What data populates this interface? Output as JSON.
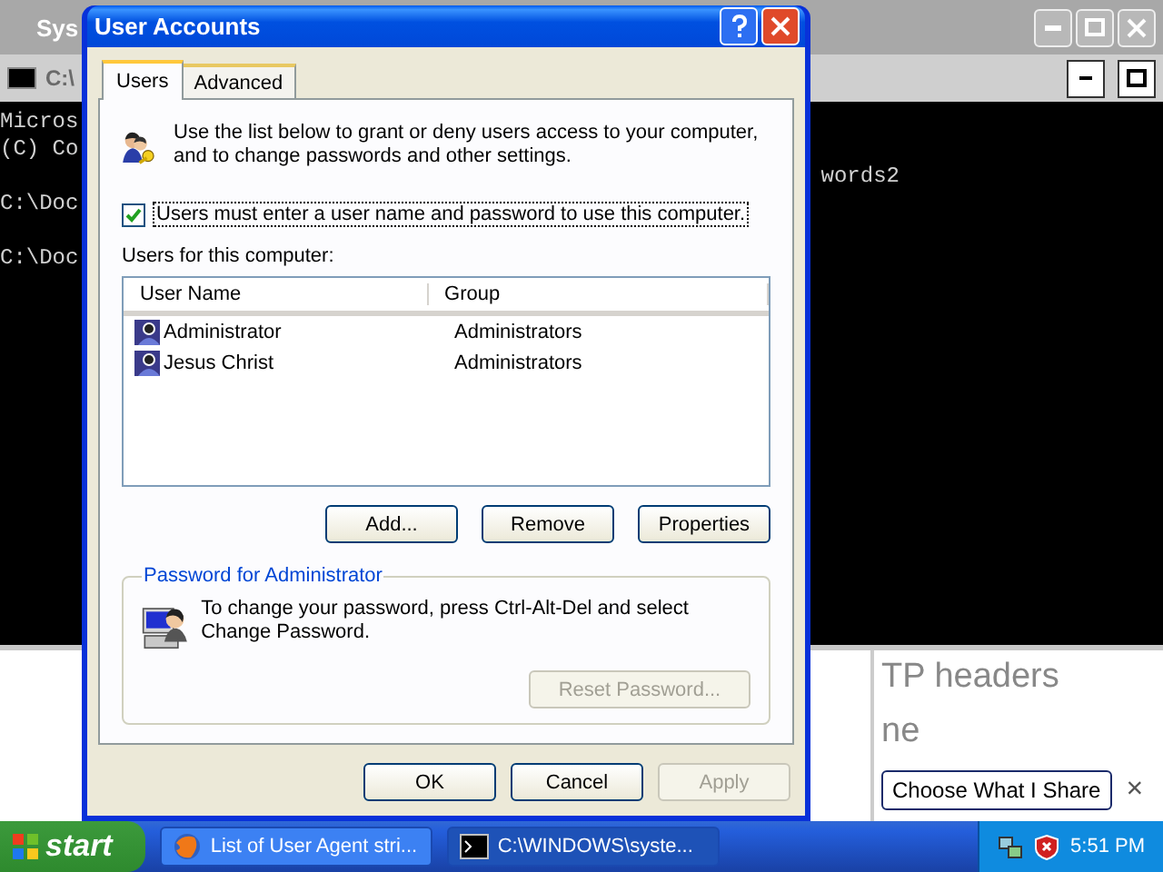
{
  "background": {
    "back_window": {
      "title": "Sys"
    },
    "console": {
      "title": "C:\\",
      "lines": [
        "Micros",
        "(C) Co",
        "C:\\Doc",
        "C:\\Doc"
      ],
      "fragment": "words2"
    },
    "browser": {
      "heading_parts": [
        "TP headers",
        "ne"
      ],
      "share_button": "Choose What I Share",
      "close_glyph": "×"
    }
  },
  "dialog": {
    "title": "User Accounts",
    "tabs": [
      {
        "label": "Users",
        "selected": true
      },
      {
        "label": "Advanced",
        "selected": false
      }
    ],
    "intro": "Use the list below to grant or deny users access to your computer, and to change passwords and other settings.",
    "require_login": {
      "label": "Users must enter a user name and password to use this computer.",
      "checked": true
    },
    "list_label": "Users for this computer:",
    "columns": [
      "User Name",
      "Group"
    ],
    "rows": [
      {
        "name": "Administrator",
        "group": "Administrators"
      },
      {
        "name": "Jesus Christ",
        "group": "Administrators"
      }
    ],
    "list_buttons": [
      {
        "label": "Add...",
        "disabled": false
      },
      {
        "label": "Remove",
        "disabled": false
      },
      {
        "label": "Properties",
        "disabled": false
      }
    ],
    "password_group": {
      "title": "Password for Administrator",
      "text": "To change your password, press Ctrl-Alt-Del and select Change Password.",
      "button": {
        "label": "Reset Password...",
        "disabled": true
      }
    },
    "footer_buttons": [
      {
        "label": "OK",
        "disabled": false
      },
      {
        "label": "Cancel",
        "disabled": false
      },
      {
        "label": "Apply",
        "disabled": true
      }
    ]
  },
  "taskbar": {
    "start": "start",
    "tasks": [
      {
        "label": "List of User Agent stri...",
        "kind": "browser",
        "selected": false
      },
      {
        "label": "C:\\WINDOWS\\syste...",
        "kind": "console",
        "selected": true
      }
    ],
    "clock": "5:51 PM"
  }
}
